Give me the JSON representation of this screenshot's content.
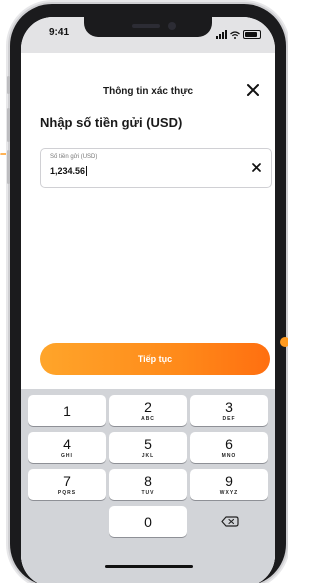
{
  "status_bar": {
    "time": "9:41"
  },
  "header": {
    "title": "Thông tin xác thực"
  },
  "page": {
    "title": "Nhập số tiền gửi (USD)"
  },
  "amount_field": {
    "label": "Số tiền gửi (USD)",
    "value": "1,234.56"
  },
  "continue_button": {
    "label": "Tiếp tục"
  },
  "keypad": {
    "keys": [
      {
        "digit": "1",
        "letters": ""
      },
      {
        "digit": "2",
        "letters": "ABC"
      },
      {
        "digit": "3",
        "letters": "DEF"
      },
      {
        "digit": "4",
        "letters": "GHI"
      },
      {
        "digit": "5",
        "letters": "JKL"
      },
      {
        "digit": "6",
        "letters": "MNO"
      },
      {
        "digit": "7",
        "letters": "PQRS"
      },
      {
        "digit": "8",
        "letters": "TUV"
      },
      {
        "digit": "9",
        "letters": "WXYZ"
      },
      {
        "digit": "0",
        "letters": ""
      }
    ]
  },
  "icons": {
    "close": "close-icon",
    "clear": "clear-icon",
    "backspace": "backspace-icon",
    "indicator_left": "arrow-right-icon",
    "indicator_right": "dot-icon"
  },
  "colors": {
    "accent_start": "#ffa52a",
    "accent_end": "#ff6f10",
    "indicator": "#ff9a1f",
    "keypad_bg": "#d2d4d8"
  }
}
